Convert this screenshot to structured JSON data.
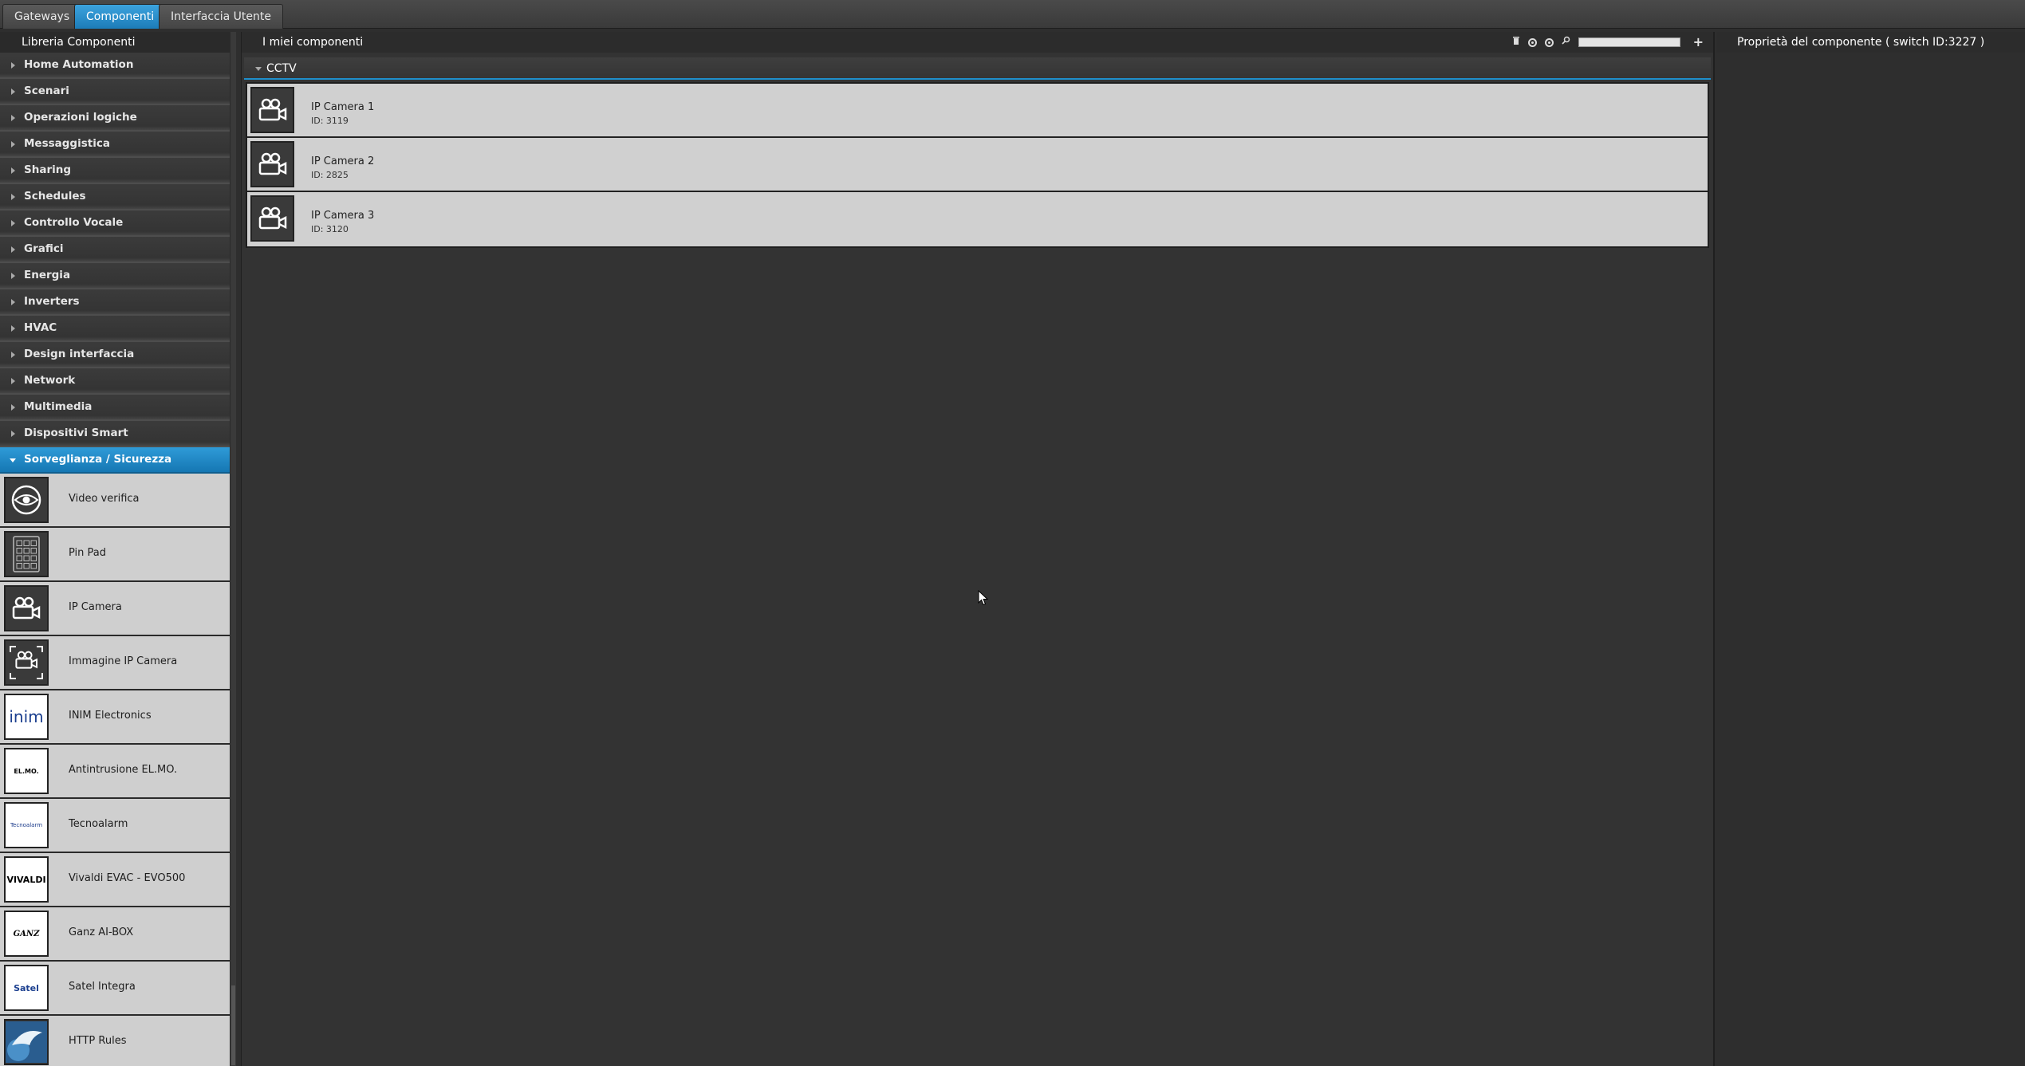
{
  "tabs": [
    {
      "label": "Gateways"
    },
    {
      "label": "Componenti"
    },
    {
      "label": "Interfaccia Utente"
    }
  ],
  "left": {
    "title": "Libreria Componenti",
    "categories": [
      {
        "label": "Home Automation"
      },
      {
        "label": "Scenari"
      },
      {
        "label": "Operazioni logiche"
      },
      {
        "label": "Messaggistica"
      },
      {
        "label": "Sharing"
      },
      {
        "label": "Schedules"
      },
      {
        "label": "Controllo Vocale"
      },
      {
        "label": "Grafici"
      },
      {
        "label": "Energia"
      },
      {
        "label": "Inverters"
      },
      {
        "label": "HVAC"
      },
      {
        "label": "Design interfaccia"
      },
      {
        "label": "Network"
      },
      {
        "label": "Multimedia"
      },
      {
        "label": "Dispositivi Smart"
      },
      {
        "label": "Sorveglianza / Sicurezza"
      }
    ],
    "components": [
      {
        "label": "Video verifica",
        "icon": "eye-icon"
      },
      {
        "label": "Pin Pad",
        "icon": "keypad-icon"
      },
      {
        "label": "IP Camera",
        "icon": "camera-icon"
      },
      {
        "label": "Immagine IP Camera",
        "icon": "camera-frame-icon"
      },
      {
        "label": "INIM Electronics",
        "icon": "inim-logo",
        "logo_text": "inim"
      },
      {
        "label": "Antintrusione EL.MO.",
        "icon": "elmo-logo",
        "logo_text": "EL.MO."
      },
      {
        "label": "Tecnoalarm",
        "icon": "tecnoalarm-logo",
        "logo_text": "Tecnoalarm"
      },
      {
        "label": "Vivaldi EVAC - EVO500",
        "icon": "vivaldi-logo",
        "logo_text": "VIVALDI"
      },
      {
        "label": "Ganz AI-BOX",
        "icon": "ganz-logo",
        "logo_text": "GANZ"
      },
      {
        "label": "Satel Integra",
        "icon": "satel-logo",
        "logo_text": "Satel"
      },
      {
        "label": "HTTP Rules",
        "icon": "http-rules-icon"
      }
    ]
  },
  "middle": {
    "title": "I miei componenti",
    "tools": [
      "trash-icon",
      "collapse-all-icon",
      "expand-all-icon",
      "search-icon",
      "add-icon"
    ],
    "search": {
      "value": "",
      "placeholder": ""
    },
    "group": "CCTV",
    "cameras": [
      {
        "name": "IP Camera 1",
        "id": "ID: 3119"
      },
      {
        "name": "IP Camera 2",
        "id": "ID: 2825"
      },
      {
        "name": "IP Camera 3",
        "id": "ID: 3120"
      }
    ]
  },
  "right": {
    "title": "Proprietà del componente ( switch ID:3227 )"
  },
  "colors": {
    "accent": "#1e8fcc",
    "panel": "#333333",
    "item_bg": "#d0d0d0"
  }
}
